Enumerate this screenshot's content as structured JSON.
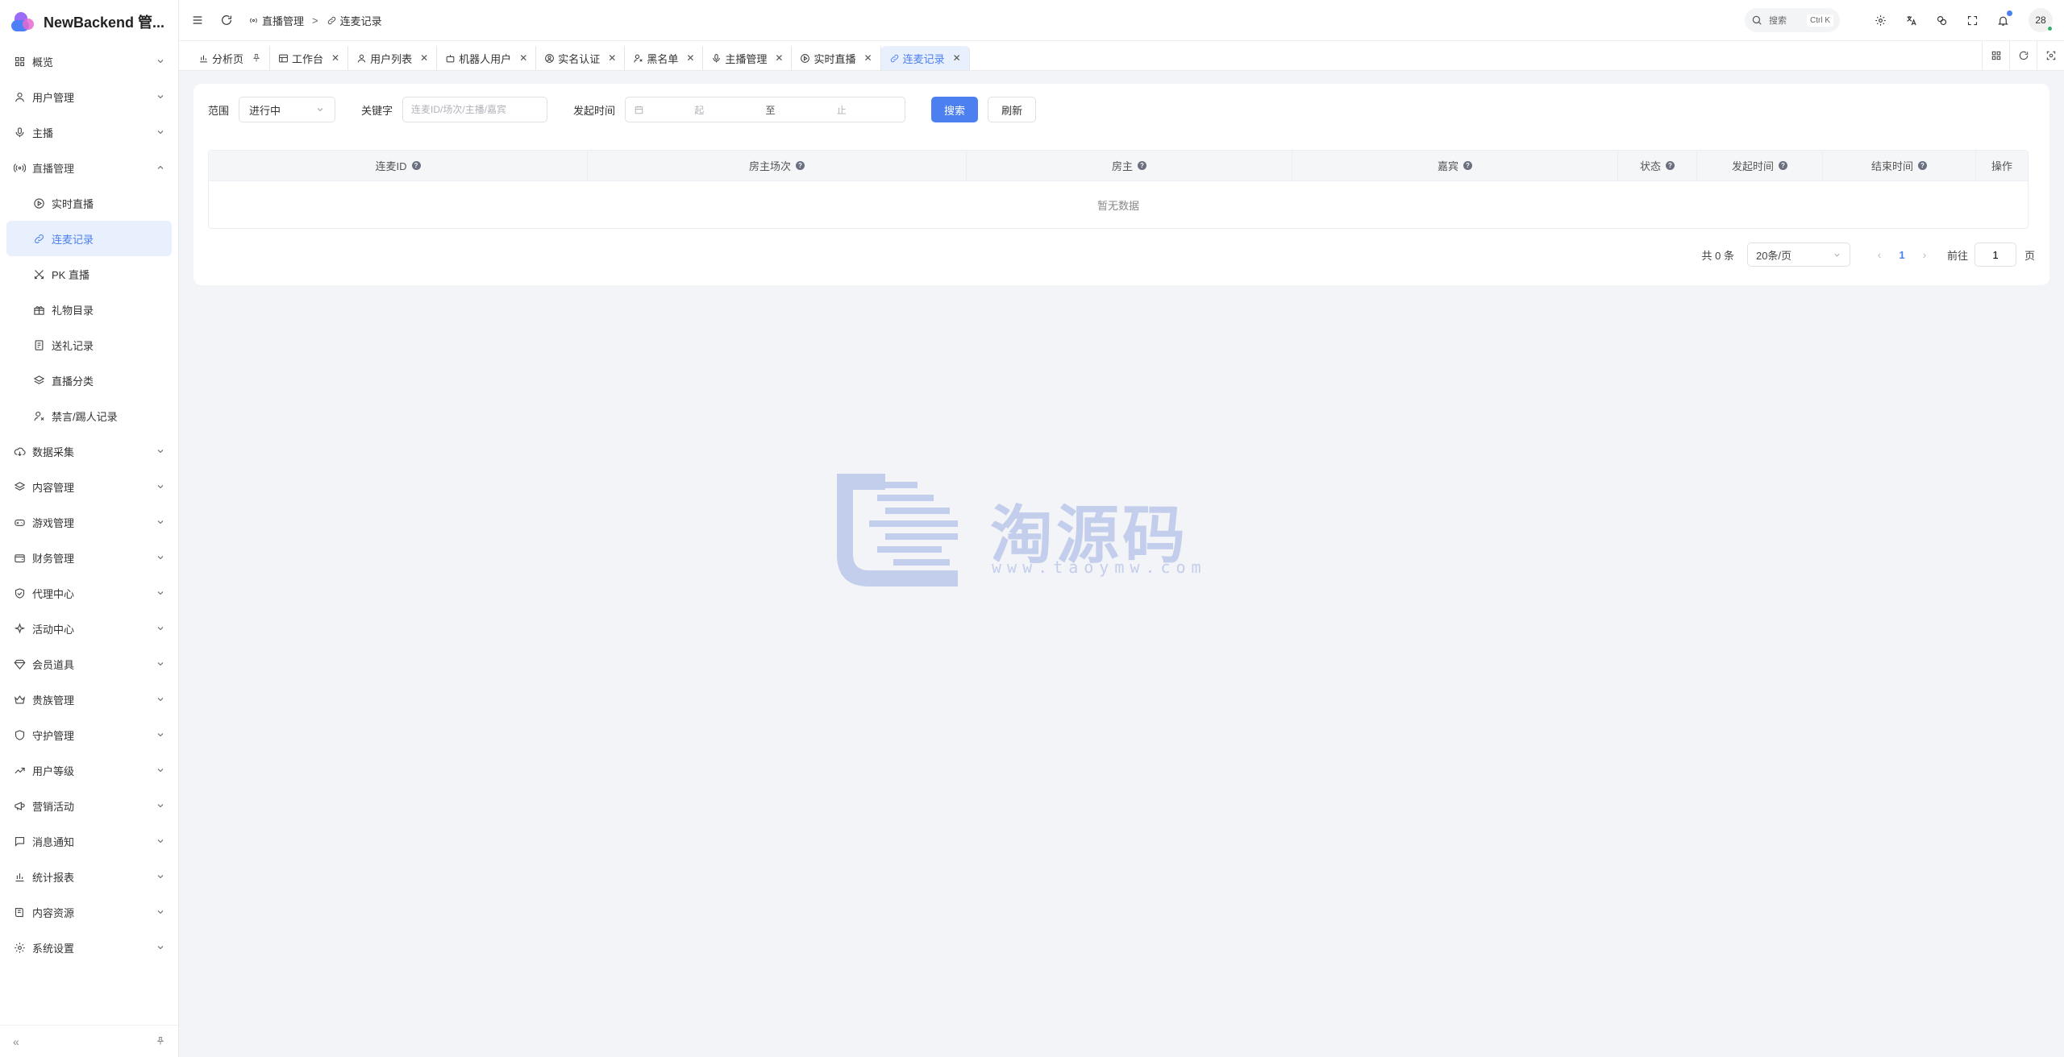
{
  "app": {
    "title": "NewBackend 管..."
  },
  "sidebar": {
    "items": [
      {
        "label": "概览",
        "icon": "grid-icon"
      },
      {
        "label": "用户管理",
        "icon": "user-icon"
      },
      {
        "label": "主播",
        "icon": "mic-icon"
      },
      {
        "label": "直播管理",
        "icon": "broadcast-icon",
        "open": true
      },
      {
        "label": "数据采集",
        "icon": "cloud-download-icon"
      },
      {
        "label": "内容管理",
        "icon": "layers-icon"
      },
      {
        "label": "游戏管理",
        "icon": "gamepad-icon"
      },
      {
        "label": "财务管理",
        "icon": "wallet-icon"
      },
      {
        "label": "代理中心",
        "icon": "shield-check-icon"
      },
      {
        "label": "活动中心",
        "icon": "sparkle-icon"
      },
      {
        "label": "会员道具",
        "icon": "gem-icon"
      },
      {
        "label": "贵族管理",
        "icon": "crown-icon"
      },
      {
        "label": "守护管理",
        "icon": "shield-icon"
      },
      {
        "label": "用户等级",
        "icon": "trend-up-icon"
      },
      {
        "label": "营销活动",
        "icon": "megaphone-icon"
      },
      {
        "label": "消息通知",
        "icon": "message-icon"
      },
      {
        "label": "统计报表",
        "icon": "bar-chart-icon"
      },
      {
        "label": "内容资源",
        "icon": "book-icon"
      },
      {
        "label": "系统设置",
        "icon": "gear-icon"
      }
    ],
    "sub_items": [
      {
        "label": "实时直播",
        "icon": "play-circle-icon"
      },
      {
        "label": "连麦记录",
        "icon": "link-icon",
        "active": true
      },
      {
        "label": "PK 直播",
        "icon": "swords-icon"
      },
      {
        "label": "礼物目录",
        "icon": "gift-icon"
      },
      {
        "label": "送礼记录",
        "icon": "receipt-icon"
      },
      {
        "label": "直播分类",
        "icon": "layers-icon"
      },
      {
        "label": "禁言/踢人记录",
        "icon": "user-x-icon"
      }
    ],
    "footer": {
      "collapse": "«",
      "pin": "pin-icon"
    }
  },
  "header": {
    "breadcrumb": [
      "直播管理",
      "连麦记录"
    ],
    "search": {
      "label": "搜索",
      "shortcut": "Ctrl K"
    },
    "avatar": "28"
  },
  "tabs": [
    {
      "label": "分析页",
      "icon": "bar-chart-icon",
      "pinned": true
    },
    {
      "label": "工作台",
      "icon": "workspace-icon"
    },
    {
      "label": "用户列表",
      "icon": "user-icon"
    },
    {
      "label": "机器人用户",
      "icon": "robot-icon"
    },
    {
      "label": "实名认证",
      "icon": "id-icon"
    },
    {
      "label": "黑名单",
      "icon": "user-block-icon"
    },
    {
      "label": "主播管理",
      "icon": "mic-icon"
    },
    {
      "label": "实时直播",
      "icon": "play-circle-icon"
    },
    {
      "label": "连麦记录",
      "icon": "link-icon",
      "active": true
    }
  ],
  "filters": {
    "scope_label": "范围",
    "scope_value": "进行中",
    "keyword_label": "关键字",
    "keyword_placeholder": "连麦ID/场次/主播/嘉宾",
    "time_label": "发起时间",
    "time_start": "起",
    "time_sep": "至",
    "time_end": "止",
    "search_btn": "搜索",
    "refresh_btn": "刷新"
  },
  "table": {
    "columns": [
      {
        "label": "连麦ID",
        "help": true
      },
      {
        "label": "房主场次",
        "help": true
      },
      {
        "label": "房主",
        "help": true
      },
      {
        "label": "嘉宾",
        "help": true
      },
      {
        "label": "状态",
        "help": true
      },
      {
        "label": "发起时间",
        "help": true
      },
      {
        "label": "结束时间",
        "help": true
      },
      {
        "label": "操作",
        "help": false
      }
    ],
    "empty_text": "暂无数据"
  },
  "pager": {
    "total": "共 0 条",
    "page_size": "20条/页",
    "current": "1",
    "goto_label": "前往",
    "goto_value": "1",
    "page_suffix": "页"
  },
  "watermark": {
    "text": "淘源码",
    "url": "www.taoymw.com"
  }
}
